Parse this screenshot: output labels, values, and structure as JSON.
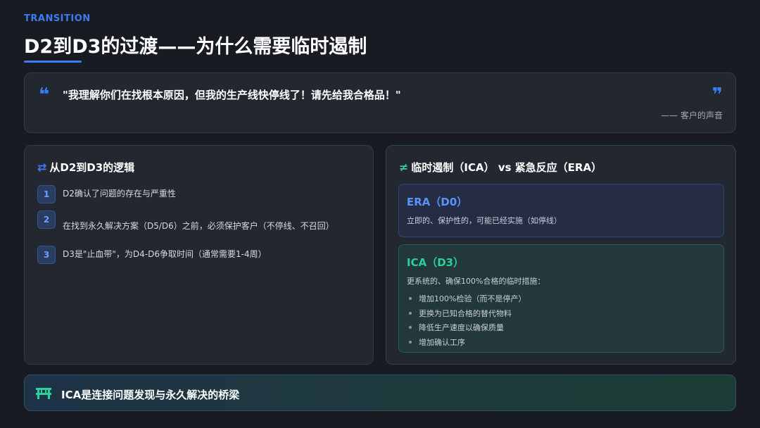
{
  "header": {
    "eyebrow": "TRANSITION",
    "title": "D2到D3的过渡——为什么需要临时遏制"
  },
  "quote": {
    "text": "\"我理解你们在找根本原因，但我的生产线快停线了！请先给我合格品！\"",
    "source": "—— 客户的声音",
    "open_icon": "quote-open-icon",
    "close_icon": "quote-close-icon"
  },
  "left_panel": {
    "icon": "swap-arrows-icon",
    "title": "从D2到D3的逻辑",
    "steps": [
      {
        "num": "1",
        "text": "D2确认了问题的存在与严重性"
      },
      {
        "num": "2",
        "text": "在找到永久解决方案（D5/D6）之前，必须保护客户（不停线、不召回）"
      },
      {
        "num": "3",
        "text": "D3是\"止血带\"，为D4-D6争取时间（通常需要1-4周）"
      }
    ]
  },
  "right_panel": {
    "icon": "not-equal-icon",
    "title": "临时遏制（ICA） vs 紧急反应（ERA）",
    "era": {
      "title": "ERA（D0）",
      "desc": "立即的、保护性的，可能已经实施（如停线）"
    },
    "ica": {
      "title": "ICA（D3）",
      "desc": "更系统的、确保100%合格的临时措施：",
      "bullets": [
        "增加100%检验（而不是停产）",
        "更换为已知合格的替代物料",
        "降低生产速度以确保质量",
        "增加确认工序"
      ]
    }
  },
  "banner": {
    "icon": "bridge-icon",
    "text": "ICA是连接问题发现与永久解决的桥梁"
  },
  "colors": {
    "background": "#181b22",
    "accent_blue": "#3d7bf5",
    "accent_green": "#2bd19a"
  }
}
